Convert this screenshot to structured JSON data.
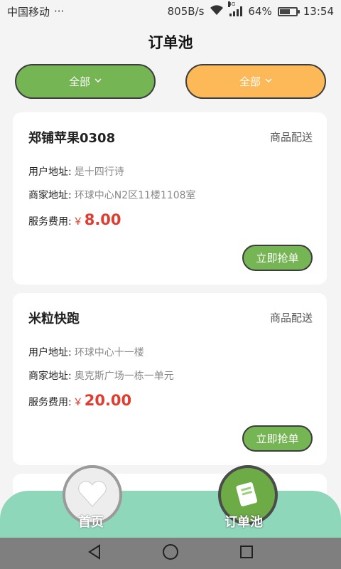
{
  "status_bar": {
    "carrier": "中国移动",
    "more": "···",
    "speed": "805B/s",
    "network_tag": "4G",
    "battery_percent": "64%",
    "battery_level": 0.64,
    "time": "13:54"
  },
  "header": {
    "title": "订单池"
  },
  "filters": [
    {
      "label": "全部",
      "icon": "chevron-down-icon",
      "color": "#75b553"
    },
    {
      "label": "全部",
      "icon": "chevron-down-icon",
      "color": "#fdb958"
    }
  ],
  "orders": [
    {
      "shop": "郑铺苹果0308",
      "type": "商品配送",
      "user_address_label": "用户地址:",
      "user_address": "是十四行诗",
      "merchant_address_label": "商家地址:",
      "merchant_address": "环球中心N2区11楼1108室",
      "fee_label": "服务费用:",
      "currency": "￥",
      "fee": "8.00",
      "action": "立即抢单"
    },
    {
      "shop": "米粒快跑",
      "type": "商品配送",
      "user_address_label": "用户地址:",
      "user_address": "环球中心十一楼",
      "merchant_address_label": "商家地址:",
      "merchant_address": "奥克斯广场一栋一单元",
      "fee_label": "服务费用:",
      "currency": "￥",
      "fee": "20.00",
      "action": "立即抢单"
    }
  ],
  "tabs": [
    {
      "label": "首页",
      "icon": "heart-icon",
      "active": false
    },
    {
      "label": "订单池",
      "icon": "document-icon",
      "active": true
    }
  ],
  "colors": {
    "accent_green": "#75b553",
    "accent_orange": "#fdb958",
    "price_red": "#e03c2f",
    "tabbar_teal": "#8ed7bb"
  }
}
